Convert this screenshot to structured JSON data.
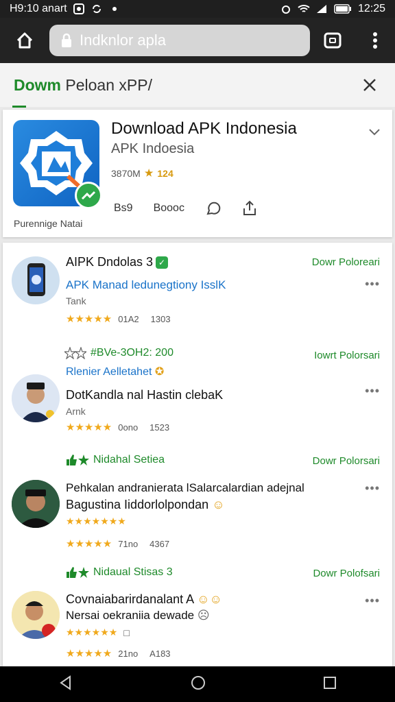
{
  "status_bar": {
    "left_text": "H9:10 anart",
    "time": "12:25"
  },
  "browser": {
    "url": "Indknlor apla"
  },
  "page": {
    "title_green": "Dowm",
    "title_dark": "Peloan хPP/"
  },
  "app": {
    "title": "Download APK Indonesia",
    "subtitle": "APK  Indoesia",
    "meta_left": "3870M",
    "meta_rank": "124",
    "caption": "Purennige Natai",
    "actions": [
      "Bs9",
      "Boooc",
      "",
      ""
    ]
  },
  "items": [
    {
      "title": "AIPK Dndolas 3",
      "subtitle": "APK Manad ledunegtiony IsslK",
      "category": "Tank",
      "stars": "★★★★★",
      "stat1": "01A2",
      "stat2": "1303",
      "download": "Dowr Poloreari"
    },
    {
      "green_label": "#BVe-3OH2: 200",
      "subtitle": "Rlenier Aelletahet",
      "title": "DotKandla nal Hastin clebaK",
      "category": "Arnk",
      "stars": "★★★★★",
      "stat1": "0ono",
      "stat2": "1523",
      "download": "Iowrt Polorsari"
    },
    {
      "green_label": "Nidahal Setiea",
      "title": "Pehkalan andranierata lSalarcalardian adejnal",
      "subtitle": "Bagustina Iiddorlolpondan",
      "rating_text": "★★★★★★★",
      "stars": "★★★★★",
      "stat1": "71no",
      "stat2": "4367",
      "download": "Dowr Polorsari"
    },
    {
      "green_label": "Nidaual Stisas 3",
      "title": "Covnaiabarirdanalant A",
      "subtitle": "Nersai oekraniia dewade",
      "rating_text": "★★★★★★",
      "stars": "★★★★★",
      "stat1": "21no",
      "stat2": "A183",
      "download": "Dowr Polofsari"
    }
  ],
  "more_label": "•••",
  "colors": {
    "accent_green": "#1e8a2a",
    "star_gold": "#f0a91c",
    "link_blue": "#1a73c9"
  }
}
